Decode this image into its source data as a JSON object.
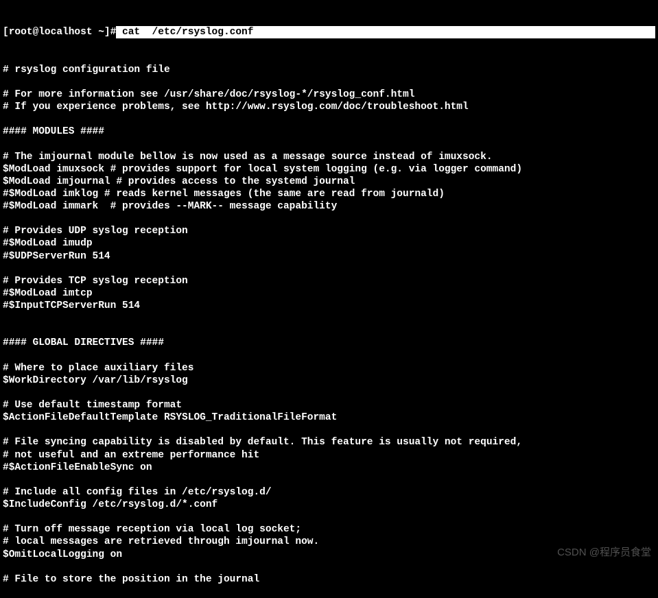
{
  "terminal": {
    "prompt": "[root@localhost ~]#",
    "command": " cat  /etc/rsyslog.conf",
    "lines": [
      "# rsyslog configuration file",
      "",
      "# For more information see /usr/share/doc/rsyslog-*/rsyslog_conf.html",
      "# If you experience problems, see http://www.rsyslog.com/doc/troubleshoot.html",
      "",
      "#### MODULES ####",
      "",
      "# The imjournal module bellow is now used as a message source instead of imuxsock.",
      "$ModLoad imuxsock # provides support for local system logging (e.g. via logger command)",
      "$ModLoad imjournal # provides access to the systemd journal",
      "#$ModLoad imklog # reads kernel messages (the same are read from journald)",
      "#$ModLoad immark  # provides --MARK-- message capability",
      "",
      "# Provides UDP syslog reception",
      "#$ModLoad imudp",
      "#$UDPServerRun 514",
      "",
      "# Provides TCP syslog reception",
      "#$ModLoad imtcp",
      "#$InputTCPServerRun 514",
      "",
      "",
      "#### GLOBAL DIRECTIVES ####",
      "",
      "# Where to place auxiliary files",
      "$WorkDirectory /var/lib/rsyslog",
      "",
      "# Use default timestamp format",
      "$ActionFileDefaultTemplate RSYSLOG_TraditionalFileFormat",
      "",
      "# File syncing capability is disabled by default. This feature is usually not required,",
      "# not useful and an extreme performance hit",
      "#$ActionFileEnableSync on",
      "",
      "# Include all config files in /etc/rsyslog.d/",
      "$IncludeConfig /etc/rsyslog.d/*.conf",
      "",
      "# Turn off message reception via local log socket;",
      "# local messages are retrieved through imjournal now.",
      "$OmitLocalLogging on",
      "",
      "# File to store the position in the journal"
    ]
  },
  "watermark": "CSDN @程序员食堂"
}
